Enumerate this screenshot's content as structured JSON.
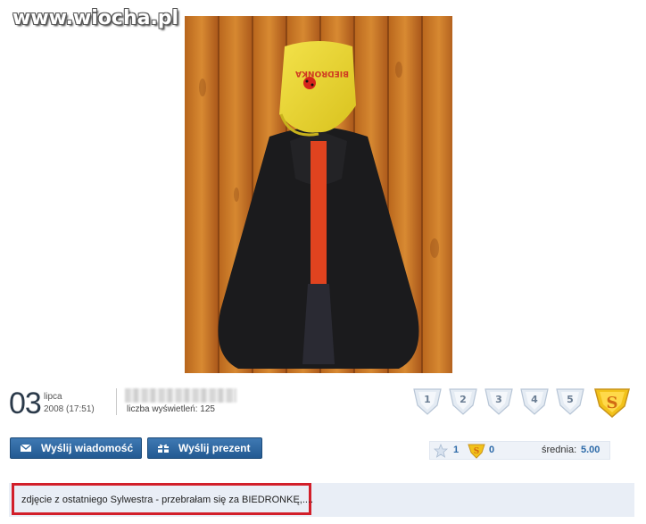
{
  "watermark": "www.wiocha.pl",
  "post": {
    "day": "03",
    "month": "lipca",
    "year_time": "2008 (17:51)",
    "views_label": "liczba wyświetleń:",
    "views_value": "125",
    "description": "zdjęcie z ostatniego Sylwestra - przebrałam się za BIEDRONKĘ,...."
  },
  "rating": {
    "stars": [
      "1",
      "2",
      "3",
      "4",
      "5"
    ],
    "star_count": "1",
    "super_count": "0",
    "average_label": "średnia:",
    "average_value": "5.00"
  },
  "buttons": {
    "send_message": "Wyślij wiadomość",
    "send_gift": "Wyślij prezent"
  },
  "photo": {
    "bag_text": "BIEDRONKA"
  },
  "colors": {
    "accent": "#2d6aa8",
    "button_bg": "#2d67a0",
    "highlight_red": "#d21f2a",
    "panel_bg": "#e9eef6"
  }
}
